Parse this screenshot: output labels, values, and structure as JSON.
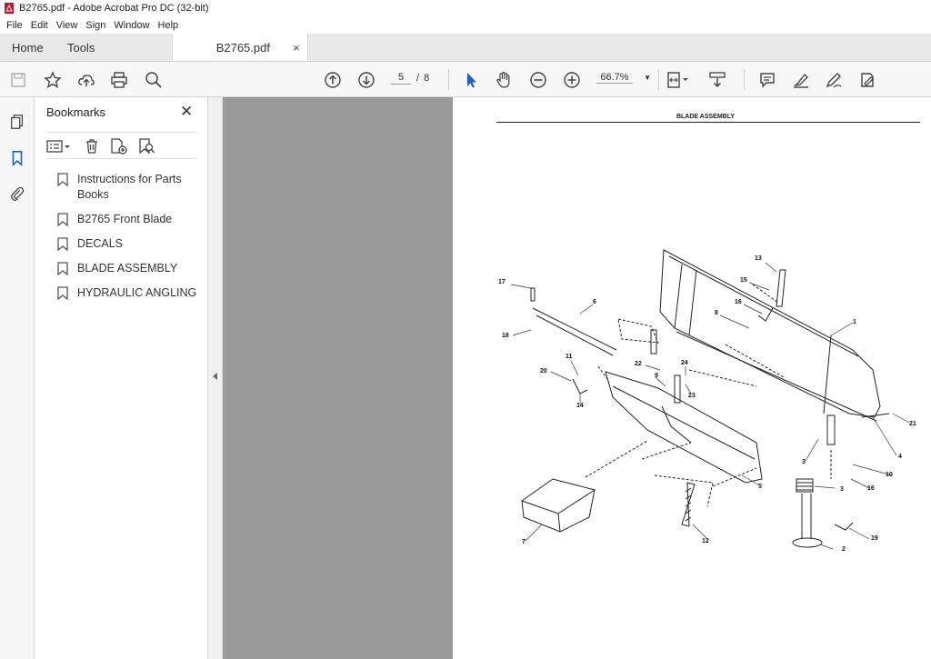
{
  "window": {
    "title": "B2765.pdf - Adobe Acrobat Pro DC (32-bit)"
  },
  "menu": [
    "File",
    "Edit",
    "View",
    "Sign",
    "Window",
    "Help"
  ],
  "tabs": {
    "home": "Home",
    "tools": "Tools",
    "doc": "B2765.pdf",
    "close": "×"
  },
  "toolbar": {
    "current_page": "5",
    "page_sep": "/",
    "total_pages": "8",
    "zoom": "66.7%"
  },
  "bookmarks": {
    "title": "Bookmarks",
    "close": "✕",
    "items": [
      {
        "label": "Instructions for Parts Books"
      },
      {
        "label": "B2765 Front Blade"
      },
      {
        "label": "DECALS"
      },
      {
        "label": "BLADE ASSEMBLY"
      },
      {
        "label": "HYDRAULIC ANGLING"
      }
    ]
  },
  "document": {
    "page_title": "BLADE ASSEMBLY",
    "callouts": [
      "1",
      "2",
      "3",
      "3",
      "4",
      "5",
      "6",
      "7",
      "8",
      "9",
      "10",
      "11",
      "12",
      "13",
      "14",
      "15",
      "16",
      "16",
      "17",
      "18",
      "19",
      "20",
      "21",
      "22",
      "23",
      "24"
    ]
  }
}
